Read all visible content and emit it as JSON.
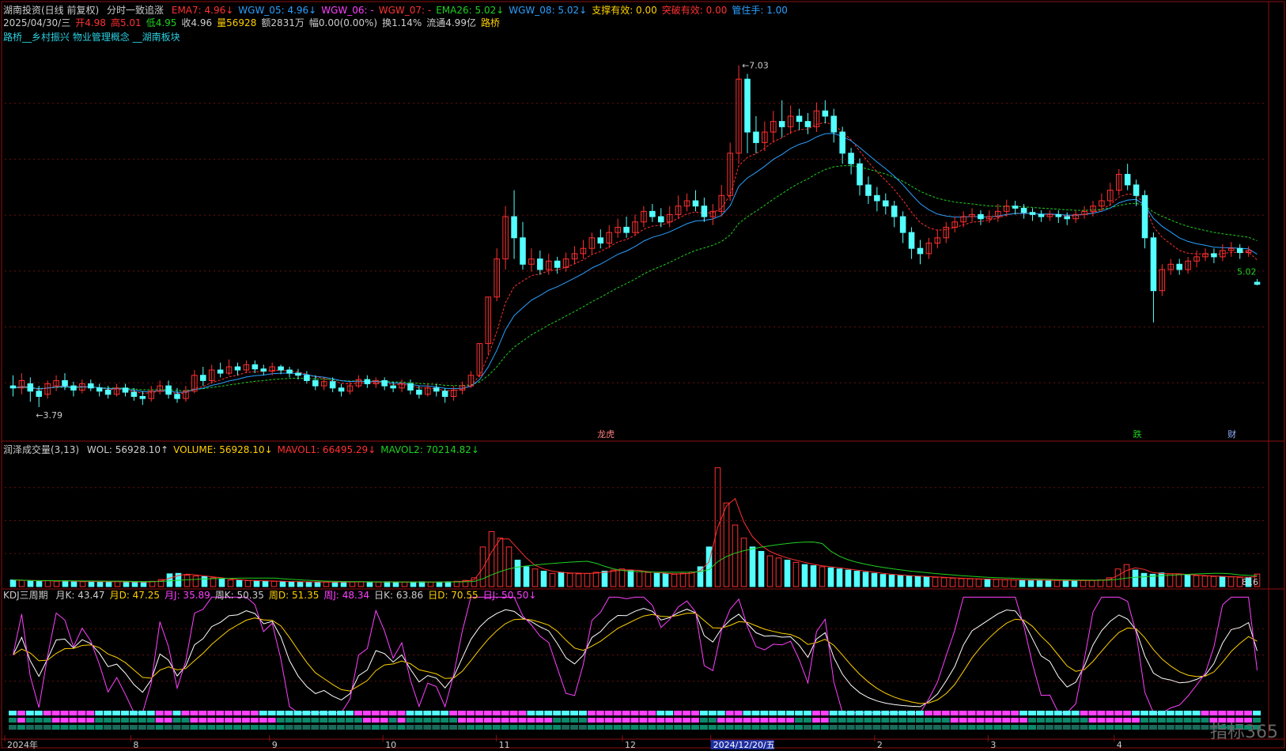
{
  "window": {
    "symbol": "湖南投资(日线 前复权)",
    "indicator": "分时一致追涨"
  },
  "price_header": {
    "items": [
      {
        "text": "EMA7: 4.96↓",
        "color": "#ff3030"
      },
      {
        "text": "WGW_05: 4.96↓",
        "color": "#2aa0ff"
      },
      {
        "text": "WGW_06: -",
        "color": "#ff40ff"
      },
      {
        "text": "WGW_07: -",
        "color": "#ff3030"
      },
      {
        "text": "EMA26: 5.02↓",
        "color": "#20d020"
      },
      {
        "text": "WGW_08: 5.02↓",
        "color": "#2aa0ff"
      },
      {
        "text": "支撑有效: 0.00",
        "color": "#ffd000"
      },
      {
        "text": "突破有效: 0.00",
        "color": "#ff3030"
      },
      {
        "text": "管住手: 1.00",
        "color": "#2aa0ff"
      }
    ],
    "row2": [
      {
        "text": "2025/04/30/三",
        "color": "#cccccc"
      },
      {
        "text": "开4.98",
        "color": "#ff3030"
      },
      {
        "text": "高5.01",
        "color": "#ff3030"
      },
      {
        "text": "低4.95",
        "color": "#20d020"
      },
      {
        "text": "收4.96",
        "color": "#cccccc"
      },
      {
        "text": "量56928",
        "color": "#ffd000"
      },
      {
        "text": "额2831万",
        "color": "#cccccc"
      },
      {
        "text": "幅0.00(0.00%)",
        "color": "#cccccc"
      },
      {
        "text": "换1.14%",
        "color": "#cccccc"
      },
      {
        "text": "流通4.99亿",
        "color": "#cccccc"
      },
      {
        "text": "路桥",
        "color": "#ffd000"
      }
    ],
    "row3": "路桥__乡村振兴 物业管理概念 __湖南板块",
    "high_label": "7.03",
    "low_label": "3.79",
    "last_label": "5.02",
    "tags": [
      "龙虎",
      "跌",
      "财"
    ]
  },
  "volume_header": {
    "title": "润泽成交量(3,13)",
    "items": [
      {
        "text": "WOL: 56928.10↑",
        "color": "#cccccc"
      },
      {
        "text": "VOLUME: 56928.10↓",
        "color": "#ffd000"
      },
      {
        "text": "MAVOL1: 66495.29↓",
        "color": "#ff3030"
      },
      {
        "text": "MAVOL2: 70214.82↓",
        "color": "#20d020"
      }
    ],
    "right_label": "816"
  },
  "kdj_header": {
    "title": "KDJ三周期",
    "items": [
      {
        "text": "月K: 43.47",
        "color": "#cccccc"
      },
      {
        "text": "月D: 47.25",
        "color": "#ffd000"
      },
      {
        "text": "月J: 35.89",
        "color": "#ff40ff"
      },
      {
        "text": "周K: 50.35",
        "color": "#cccccc"
      },
      {
        "text": "周D: 51.35",
        "color": "#ffd000"
      },
      {
        "text": "周J: 48.34",
        "color": "#ff40ff"
      },
      {
        "text": "日K: 63.86",
        "color": "#cccccc"
      },
      {
        "text": "日D: 70.55",
        "color": "#ffd000"
      },
      {
        "text": "日J: 50.50↓",
        "color": "#ff40ff"
      }
    ]
  },
  "xaxis": {
    "labels": [
      "2024年",
      "8",
      "9",
      "10",
      "11",
      "12",
      "2024/12/20/五",
      "2",
      "3",
      "4"
    ]
  },
  "watermark": "指标365",
  "chart_data": [
    {
      "type": "candlestick",
      "title": "湖南投资(日线 前复权)",
      "ylim": [
        3.5,
        7.2
      ],
      "y_unit": "price",
      "candles": [
        [
          4.0,
          3.98,
          4.1,
          3.9
        ],
        [
          3.98,
          4.05,
          4.12,
          3.92
        ],
        [
          4.02,
          3.95,
          4.08,
          3.85
        ],
        [
          3.95,
          3.9,
          4.0,
          3.8
        ],
        [
          3.92,
          4.02,
          4.05,
          3.88
        ],
        [
          4.0,
          4.05,
          4.1,
          3.95
        ],
        [
          4.05,
          4.0,
          4.12,
          3.96
        ],
        [
          4.0,
          3.96,
          4.04,
          3.9
        ],
        [
          3.96,
          4.02,
          4.06,
          3.93
        ],
        [
          4.02,
          3.98,
          4.06,
          3.95
        ],
        [
          3.98,
          3.95,
          4.02,
          3.9
        ],
        [
          3.96,
          3.92,
          4.0,
          3.88
        ],
        [
          3.92,
          3.98,
          4.02,
          3.9
        ],
        [
          3.98,
          3.94,
          4.02,
          3.9
        ],
        [
          3.94,
          3.9,
          3.98,
          3.86
        ],
        [
          3.9,
          3.88,
          3.95,
          3.82
        ],
        [
          3.88,
          3.95,
          4.0,
          3.85
        ],
        [
          3.95,
          4.0,
          4.05,
          3.92
        ],
        [
          4.0,
          3.92,
          4.05,
          3.88
        ],
        [
          3.92,
          3.88,
          3.98,
          3.84
        ],
        [
          3.88,
          3.95,
          4.0,
          3.85
        ],
        [
          3.95,
          4.1,
          4.15,
          3.93
        ],
        [
          4.1,
          4.05,
          4.18,
          4.0
        ],
        [
          4.05,
          4.15,
          4.2,
          4.02
        ],
        [
          4.15,
          4.12,
          4.22,
          4.08
        ],
        [
          4.12,
          4.18,
          4.25,
          4.1
        ],
        [
          4.18,
          4.15,
          4.22,
          4.1
        ],
        [
          4.15,
          4.2,
          4.24,
          4.12
        ],
        [
          4.2,
          4.16,
          4.24,
          4.12
        ],
        [
          4.16,
          4.14,
          4.2,
          4.1
        ],
        [
          4.14,
          4.18,
          4.22,
          4.1
        ],
        [
          4.18,
          4.15,
          4.2,
          4.11
        ],
        [
          4.15,
          4.12,
          4.18,
          4.08
        ],
        [
          4.12,
          4.1,
          4.16,
          4.06
        ],
        [
          4.1,
          4.05,
          4.14,
          4.02
        ],
        [
          4.05,
          4.0,
          4.1,
          3.96
        ],
        [
          4.0,
          4.04,
          4.08,
          3.96
        ],
        [
          4.04,
          3.98,
          4.08,
          3.94
        ],
        [
          3.98,
          3.95,
          4.02,
          3.9
        ],
        [
          3.95,
          4.0,
          4.04,
          3.92
        ],
        [
          4.0,
          4.06,
          4.1,
          3.98
        ],
        [
          4.06,
          4.02,
          4.1,
          3.98
        ],
        [
          4.02,
          4.05,
          4.08,
          3.98
        ],
        [
          4.05,
          4.0,
          4.08,
          3.96
        ],
        [
          4.0,
          3.98,
          4.04,
          3.94
        ],
        [
          3.98,
          4.02,
          4.06,
          3.94
        ],
        [
          4.02,
          3.96,
          4.06,
          3.92
        ],
        [
          3.96,
          3.92,
          4.0,
          3.88
        ],
        [
          3.92,
          3.98,
          4.02,
          3.9
        ],
        [
          3.98,
          3.95,
          4.02,
          3.9
        ],
        [
          3.95,
          3.9,
          3.98,
          3.84
        ],
        [
          3.9,
          3.96,
          4.0,
          3.86
        ],
        [
          3.96,
          4.0,
          4.04,
          3.92
        ],
        [
          4.0,
          4.1,
          4.14,
          3.98
        ],
        [
          4.1,
          4.4,
          4.4,
          4.08
        ],
        [
          4.4,
          4.84,
          4.84,
          4.3
        ],
        [
          4.84,
          5.2,
          5.3,
          4.8
        ],
        [
          5.2,
          5.6,
          5.7,
          5.1
        ],
        [
          5.6,
          5.4,
          5.85,
          5.2
        ],
        [
          5.4,
          5.15,
          5.55,
          5.1
        ],
        [
          5.15,
          5.2,
          5.3,
          5.08
        ],
        [
          5.2,
          5.1,
          5.28,
          5.05
        ],
        [
          5.1,
          5.18,
          5.25,
          5.05
        ],
        [
          5.18,
          5.12,
          5.22,
          5.06
        ],
        [
          5.12,
          5.2,
          5.26,
          5.08
        ],
        [
          5.2,
          5.25,
          5.32,
          5.15
        ],
        [
          5.25,
          5.3,
          5.38,
          5.2
        ],
        [
          5.3,
          5.4,
          5.45,
          5.25
        ],
        [
          5.4,
          5.35,
          5.48,
          5.3
        ],
        [
          5.35,
          5.45,
          5.52,
          5.3
        ],
        [
          5.45,
          5.5,
          5.58,
          5.4
        ],
        [
          5.5,
          5.45,
          5.6,
          5.4
        ],
        [
          5.45,
          5.55,
          5.62,
          5.42
        ],
        [
          5.55,
          5.65,
          5.7,
          5.5
        ],
        [
          5.65,
          5.6,
          5.72,
          5.55
        ],
        [
          5.6,
          5.55,
          5.68,
          5.5
        ],
        [
          5.55,
          5.62,
          5.7,
          5.5
        ],
        [
          5.62,
          5.7,
          5.8,
          5.58
        ],
        [
          5.7,
          5.75,
          5.82,
          5.65
        ],
        [
          5.75,
          5.7,
          5.85,
          5.65
        ],
        [
          5.7,
          5.6,
          5.78,
          5.55
        ],
        [
          5.6,
          5.65,
          5.72,
          5.52
        ],
        [
          5.65,
          5.8,
          5.9,
          5.6
        ],
        [
          5.8,
          6.2,
          6.3,
          5.75
        ],
        [
          6.2,
          6.9,
          7.03,
          6.1
        ],
        [
          6.9,
          6.4,
          6.95,
          6.2
        ],
        [
          6.4,
          6.3,
          6.55,
          6.2
        ],
        [
          6.3,
          6.4,
          6.5,
          6.22
        ],
        [
          6.4,
          6.5,
          6.6,
          6.3
        ],
        [
          6.5,
          6.45,
          6.7,
          6.35
        ],
        [
          6.45,
          6.55,
          6.65,
          6.38
        ],
        [
          6.55,
          6.5,
          6.62,
          6.42
        ],
        [
          6.5,
          6.45,
          6.58,
          6.38
        ],
        [
          6.45,
          6.6,
          6.68,
          6.4
        ],
        [
          6.6,
          6.55,
          6.7,
          6.48
        ],
        [
          6.55,
          6.4,
          6.62,
          6.3
        ],
        [
          6.4,
          6.2,
          6.45,
          6.1
        ],
        [
          6.2,
          6.1,
          6.25,
          6.0
        ],
        [
          6.1,
          5.9,
          6.15,
          5.8
        ],
        [
          5.9,
          5.8,
          5.98,
          5.72
        ],
        [
          5.8,
          5.75,
          5.88,
          5.65
        ],
        [
          5.75,
          5.7,
          5.82,
          5.62
        ],
        [
          5.7,
          5.6,
          5.75,
          5.5
        ],
        [
          5.6,
          5.45,
          5.65,
          5.35
        ],
        [
          5.45,
          5.3,
          5.5,
          5.2
        ],
        [
          5.3,
          5.25,
          5.38,
          5.15
        ],
        [
          5.25,
          5.35,
          5.4,
          5.2
        ],
        [
          5.35,
          5.4,
          5.48,
          5.3
        ],
        [
          5.4,
          5.5,
          5.55,
          5.35
        ],
        [
          5.5,
          5.55,
          5.6,
          5.45
        ],
        [
          5.55,
          5.6,
          5.65,
          5.5
        ],
        [
          5.6,
          5.62,
          5.68,
          5.55
        ],
        [
          5.62,
          5.58,
          5.66,
          5.52
        ],
        [
          5.58,
          5.6,
          5.66,
          5.54
        ],
        [
          5.6,
          5.65,
          5.72,
          5.55
        ],
        [
          5.65,
          5.7,
          5.76,
          5.6
        ],
        [
          5.7,
          5.68,
          5.75,
          5.62
        ],
        [
          5.68,
          5.64,
          5.72,
          5.58
        ],
        [
          5.64,
          5.62,
          5.68,
          5.56
        ],
        [
          5.62,
          5.6,
          5.66,
          5.55
        ],
        [
          5.6,
          5.62,
          5.66,
          5.56
        ],
        [
          5.62,
          5.6,
          5.66,
          5.54
        ],
        [
          5.6,
          5.58,
          5.64,
          5.52
        ],
        [
          5.58,
          5.62,
          5.66,
          5.54
        ],
        [
          5.62,
          5.65,
          5.7,
          5.58
        ],
        [
          5.65,
          5.7,
          5.75,
          5.6
        ],
        [
          5.7,
          5.75,
          5.82,
          5.65
        ],
        [
          5.75,
          5.85,
          5.92,
          5.7
        ],
        [
          5.85,
          6.0,
          6.05,
          5.8
        ],
        [
          6.0,
          5.9,
          6.1,
          5.85
        ],
        [
          5.9,
          5.8,
          5.95,
          5.7
        ],
        [
          5.8,
          5.4,
          5.85,
          5.3
        ],
        [
          5.4,
          4.9,
          5.45,
          4.6
        ],
        [
          4.9,
          5.1,
          5.15,
          4.85
        ],
        [
          5.1,
          5.15,
          5.2,
          5.05
        ],
        [
          5.15,
          5.1,
          5.2,
          5.05
        ],
        [
          5.1,
          5.18,
          5.22,
          5.06
        ],
        [
          5.18,
          5.22,
          5.28,
          5.12
        ],
        [
          5.22,
          5.25,
          5.3,
          5.18
        ],
        [
          5.25,
          5.22,
          5.3,
          5.16
        ],
        [
          5.22,
          5.28,
          5.34,
          5.18
        ],
        [
          5.28,
          5.3,
          5.36,
          5.22
        ],
        [
          5.3,
          5.26,
          5.34,
          5.2
        ],
        [
          5.26,
          5.28,
          5.32,
          5.22
        ],
        [
          4.98,
          4.96,
          5.01,
          4.95
        ]
      ],
      "series": [
        {
          "name": "EMA7",
          "color": "#ff3030",
          "dashed": true
        },
        {
          "name": "EMA26",
          "color": "#20d020",
          "dashed": true
        },
        {
          "name": "WGW_08",
          "color": "#2aa0ff",
          "dashed": false
        }
      ]
    },
    {
      "type": "bar",
      "title": "润泽成交量(3,13)",
      "ylim": [
        0,
        600000
      ],
      "values": [
        30000,
        28000,
        26000,
        25000,
        27000,
        24000,
        26000,
        23000,
        22000,
        24000,
        22000,
        21000,
        23000,
        22000,
        20000,
        21000,
        24000,
        32000,
        58000,
        60000,
        52000,
        48000,
        45000,
        40000,
        35000,
        30000,
        28000,
        27000,
        26000,
        25000,
        24000,
        23000,
        22000,
        22000,
        21000,
        21000,
        20000,
        20000,
        22000,
        21000,
        22000,
        21000,
        20000,
        22000,
        21000,
        20000,
        21000,
        22000,
        20000,
        21000,
        22000,
        24000,
        28000,
        40000,
        180000,
        250000,
        220000,
        180000,
        120000,
        90000,
        80000,
        70000,
        60000,
        65000,
        60000,
        58000,
        60000,
        65000,
        70000,
        75000,
        80000,
        72000,
        68000,
        64000,
        60000,
        58000,
        56000,
        60000,
        66000,
        90000,
        180000,
        540000,
        380000,
        280000,
        220000,
        180000,
        160000,
        140000,
        130000,
        120000,
        110000,
        100000,
        95000,
        90000,
        85000,
        80000,
        75000,
        70000,
        65000,
        60000,
        55000,
        52000,
        50000,
        48000,
        46000,
        44000,
        42000,
        40000,
        38000,
        36000,
        35000,
        34000,
        33000,
        32000,
        31000,
        30000,
        30000,
        29000,
        29000,
        28000,
        28000,
        28000,
        27000,
        27000,
        28000,
        30000,
        40000,
        80000,
        100000,
        75000,
        60000,
        56000,
        62000,
        58000,
        55000,
        52000,
        50000,
        48000,
        46000,
        45000,
        44000,
        42000,
        40000,
        56928
      ],
      "series": [
        {
          "name": "MAVOL1",
          "color": "#ff3030"
        },
        {
          "name": "MAVOL2",
          "color": "#20d020"
        }
      ]
    },
    {
      "type": "line",
      "title": "KDJ三周期",
      "ylim": [
        0,
        100
      ],
      "series": [
        {
          "name": "月K",
          "color": "#ffffff"
        },
        {
          "name": "月D",
          "color": "#ffd000"
        },
        {
          "name": "月J",
          "color": "#ff40ff"
        }
      ]
    }
  ]
}
